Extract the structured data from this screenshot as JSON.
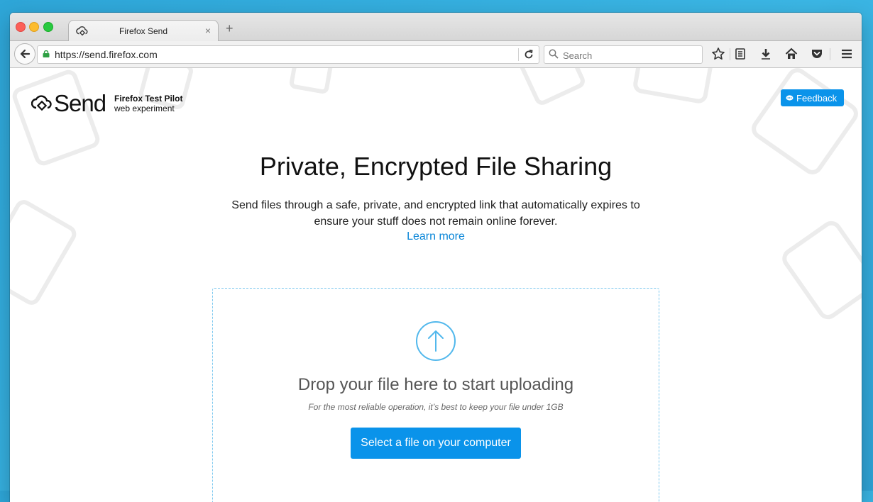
{
  "browser": {
    "tab": {
      "title": "Firefox Send",
      "close_glyph": "×",
      "icon": "send-cloud-icon"
    },
    "new_tab_glyph": "+",
    "url": "https://send.firefox.com",
    "search": {
      "placeholder": "Search"
    }
  },
  "header": {
    "logo_word": "Send",
    "logo_line1": "Firefox Test Pilot",
    "logo_line2": "web experiment",
    "feedback_label": "Feedback"
  },
  "hero": {
    "title": "Private, Encrypted File Sharing",
    "description": "Send files through a safe, private, and encrypted link that automatically expires to ensure your stuff does not remain online forever.",
    "learn_more": "Learn more"
  },
  "upload": {
    "title": "Drop your file here to start uploading",
    "hint": "For the most reliable operation, it’s best to keep your file under 1GB",
    "button_label": "Select a file on your computer"
  },
  "colors": {
    "accent": "#0a93ea",
    "link": "#0a86d8",
    "dropzone_border": "#7cc8ef",
    "desktop_bg": "#3bb6e4"
  }
}
